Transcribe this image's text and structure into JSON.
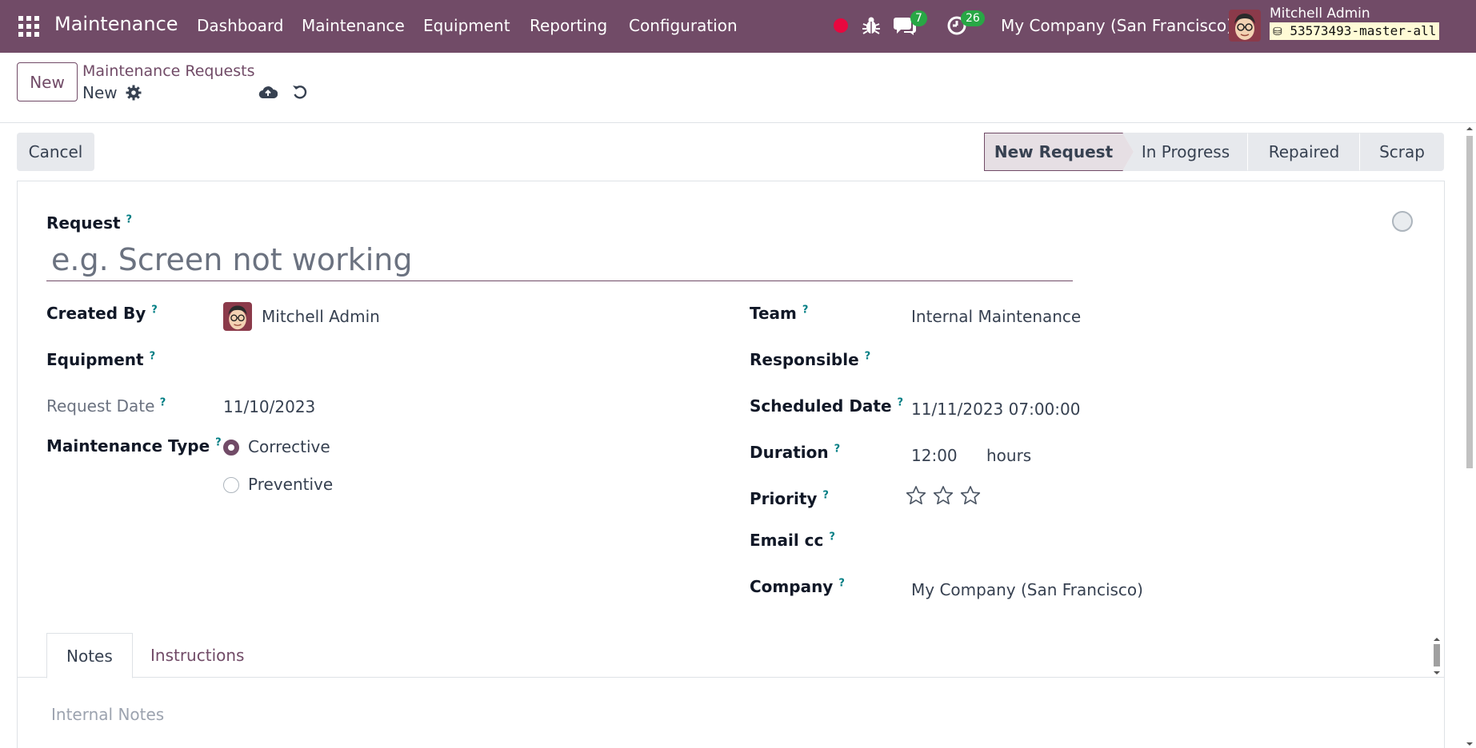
{
  "navbar": {
    "app_name": "Maintenance",
    "menu": [
      "Dashboard",
      "Maintenance",
      "Equipment",
      "Reporting",
      "Configuration"
    ],
    "messages_count": "7",
    "activities_count": "26",
    "company": "My Company (San Francisco)",
    "user": "Mitchell Admin",
    "database": "53573493-master-all"
  },
  "control": {
    "new_label": "New",
    "breadcrumb": "Maintenance Requests",
    "record": "New"
  },
  "statusbar": {
    "cancel_label": "Cancel",
    "stages": [
      "New Request",
      "In Progress",
      "Repaired",
      "Scrap"
    ],
    "active_stage": "New Request"
  },
  "form": {
    "request_label": "Request",
    "request_placeholder": "e.g. Screen not working",
    "created_by_label": "Created By",
    "created_by": "Mitchell Admin",
    "equipment_label": "Equipment",
    "request_date_label": "Request Date",
    "request_date": "11/10/2023",
    "maintenance_type_label": "Maintenance Type",
    "maintenance_types": [
      "Corrective",
      "Preventive"
    ],
    "maintenance_type_selected": "Corrective",
    "team_label": "Team",
    "team": "Internal Maintenance",
    "responsible_label": "Responsible",
    "scheduled_date_label": "Scheduled Date",
    "scheduled_date": "11/11/2023 07:00:00",
    "duration_label": "Duration",
    "duration": "12:00",
    "duration_unit": "hours",
    "priority_label": "Priority",
    "priority_stars": 0,
    "priority_max": 3,
    "email_cc_label": "Email cc",
    "company_label": "Company",
    "company": "My Company (San Francisco)",
    "help_mark": "?"
  },
  "notebook": {
    "tabs": [
      "Notes",
      "Instructions"
    ],
    "active_tab": "Notes",
    "notes_placeholder": "Internal Notes"
  },
  "colors": {
    "brand": "#714b67",
    "help": "#017e84",
    "badge": "#28a745",
    "record_dot": "#e7083f"
  }
}
